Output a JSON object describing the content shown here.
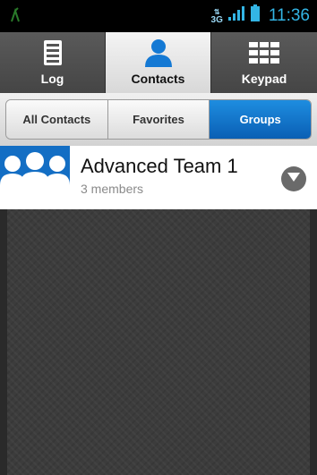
{
  "status_bar": {
    "network_label": "3G",
    "time": "11:36",
    "icons": [
      "notification-icon",
      "signal-icon",
      "battery-icon"
    ]
  },
  "tabs": [
    {
      "label": "Log",
      "icon": "log-icon",
      "active": false
    },
    {
      "label": "Contacts",
      "icon": "contacts-icon",
      "active": true
    },
    {
      "label": "Keypad",
      "icon": "keypad-icon",
      "active": false
    }
  ],
  "subtabs": [
    {
      "label": "All Contacts",
      "active": false
    },
    {
      "label": "Favorites",
      "active": false
    },
    {
      "label": "Groups",
      "active": true
    }
  ],
  "groups": [
    {
      "name": "Advanced Team 1",
      "members": "3 members",
      "icon": "group-icon"
    }
  ],
  "colors": {
    "accent": "#1479d4",
    "clock": "#33b5e5",
    "active_tab_bg": "#ebebeb",
    "avatar_bg": "#136ec4"
  }
}
